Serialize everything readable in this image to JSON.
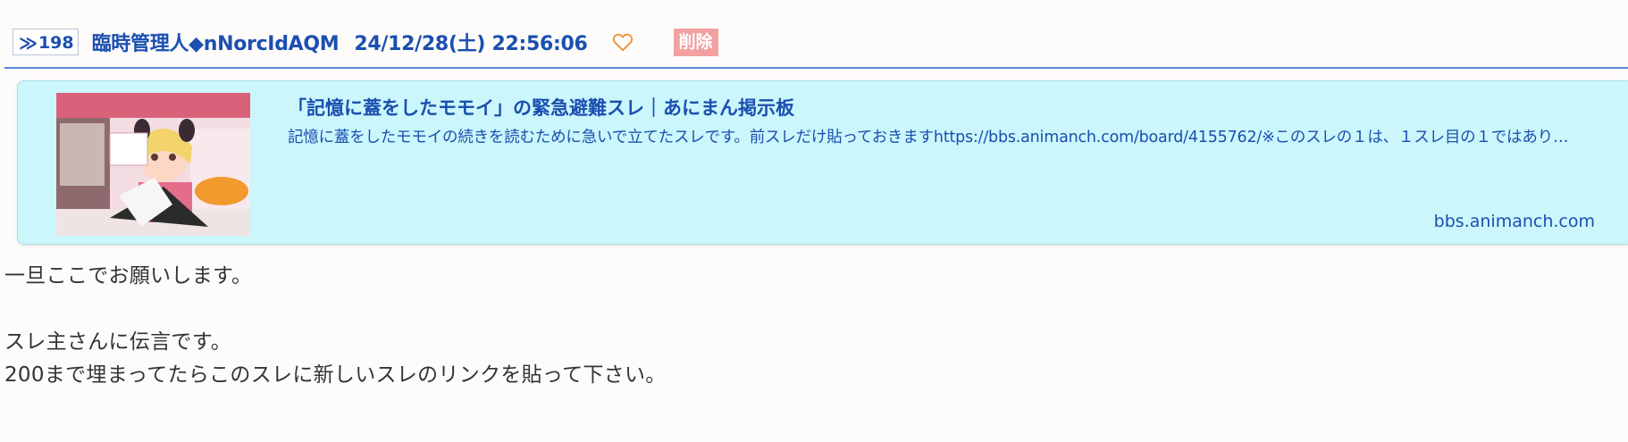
{
  "post": {
    "number_prefix": "≫",
    "number": "198",
    "poster_name": "臨時管理人◆nNorcIdAQM",
    "datetime": "24/12/28(土) 22:56:06",
    "like_icon": "heart-outline-icon",
    "delete_label": "削除",
    "accent_color": "#1b4fb0",
    "delete_color": "#f2a0a0"
  },
  "link_card": {
    "title": "「記憶に蓋をしたモモイ」の緊急避難スレ｜あにまん掲示板",
    "description": "記憶に蓋をしたモモイの続きを読むために急いで立てたスレです。前スレだけ貼っておきますhttps://bbs.animanch.com/board/4155762/※このスレの１は、１スレ目の１ではあり…",
    "domain": "bbs.animanch.com",
    "background_color": "#cbf6fb"
  },
  "body": {
    "lines": [
      "一旦ここでお願いします。",
      "",
      "スレ主さんに伝言です。",
      "200まで埋まってたらこのスレに新しいスレのリンクを貼って下さい。"
    ]
  }
}
